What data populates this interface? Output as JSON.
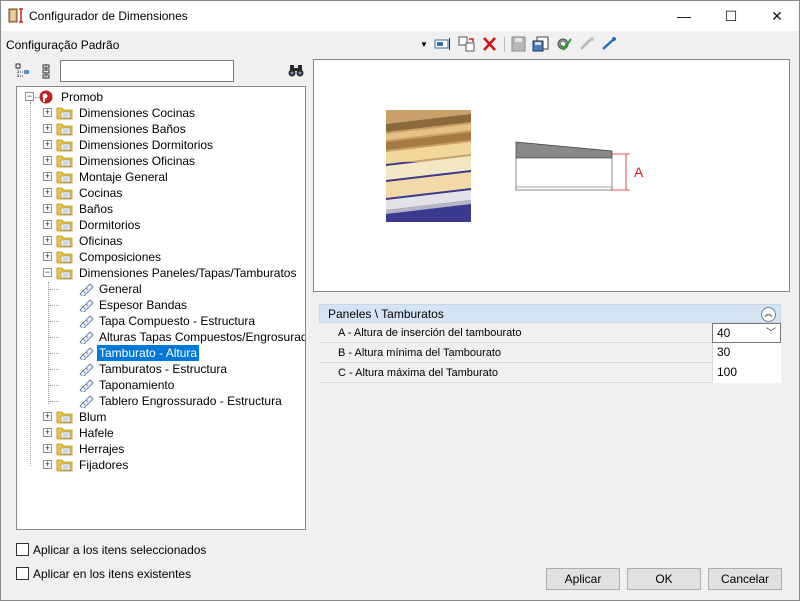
{
  "window": {
    "title": "Configurador de Dimensiones",
    "minimize": "—",
    "maximize": "☐",
    "close": "✕"
  },
  "toolbar": {
    "config_label": "Configuração Padrão"
  },
  "search": {
    "value": "",
    "placeholder": ""
  },
  "tree": {
    "root": "Promob",
    "folders": [
      "Dimensiones Cocinas",
      "Dimensiones Baños",
      "Dimensiones Dormitorios",
      "Dimensiones Oficinas",
      "Montaje General",
      "Cocinas",
      "Baños",
      "Dormitorios",
      "Oficinas",
      "Composiciones",
      "Dimensiones Paneles/Tapas/Tamburatos"
    ],
    "children": [
      "General",
      "Espesor Bandas",
      "Tapa Compuesto - Estructura",
      "Alturas Tapas Compuestos/Engrosurado",
      "Tamburato - Altura",
      "Tamburatos - Estructura",
      "Taponamiento",
      "Tablero Engrossurado - Estructura"
    ],
    "selected_child": "Tamburato - Altura",
    "folders_after": [
      "Blum",
      "Hafele",
      "Herrajes",
      "Fijadores"
    ]
  },
  "preview": {
    "dimension_label": "A"
  },
  "props": {
    "header": "Paneles \\ Tamburatos",
    "rows": [
      {
        "label": "A - Altura de inserción del tambourato",
        "value": "40"
      },
      {
        "label": "B - Altura mínima del Tambourato",
        "value": "30"
      },
      {
        "label": "C - Altura máxima del Tamburato",
        "value": "100"
      }
    ]
  },
  "options": {
    "apply_selected": "Aplicar a los itens seleccionados",
    "apply_existing": "Aplicar en los itens existentes"
  },
  "buttons": {
    "apply": "Aplicar",
    "ok": "OK",
    "cancel": "Cancelar"
  },
  "colors": {
    "selection": "#0078d7",
    "delete_icon": "#d01010",
    "dimension_red": "#e0202a"
  }
}
